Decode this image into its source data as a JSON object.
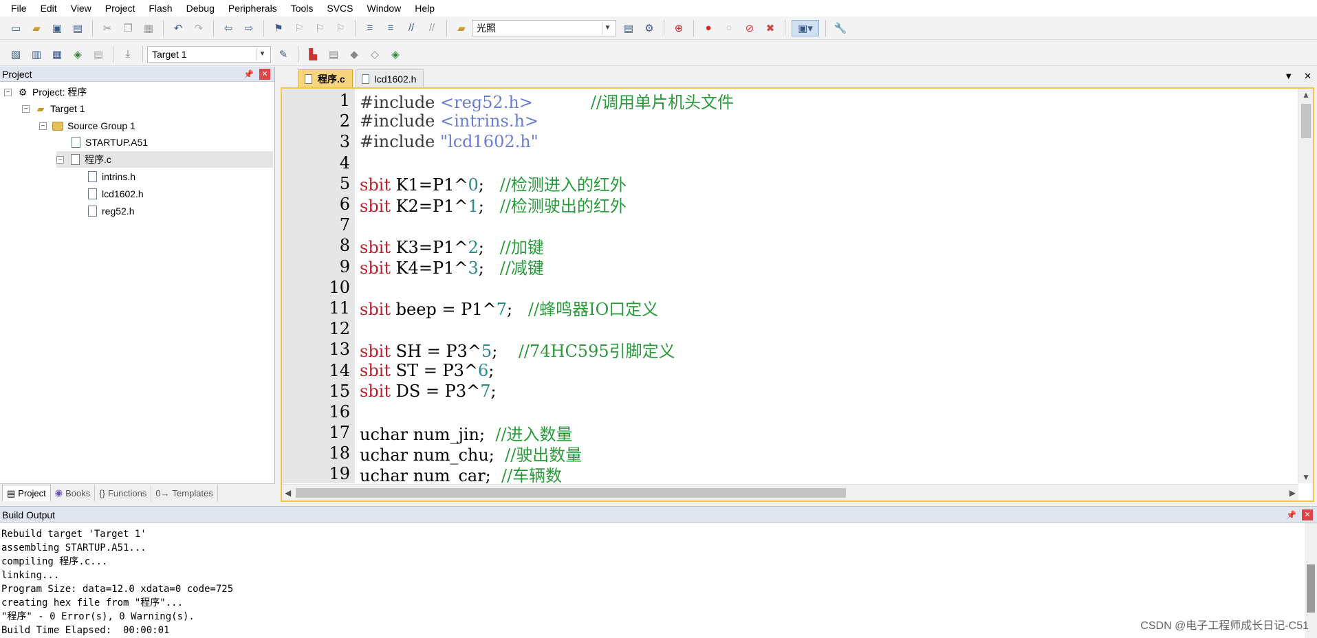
{
  "menu": [
    "File",
    "Edit",
    "View",
    "Project",
    "Flash",
    "Debug",
    "Peripherals",
    "Tools",
    "SVCS",
    "Window",
    "Help"
  ],
  "toolbar1": {
    "find_value": "光照"
  },
  "toolbar2": {
    "target_value": "Target 1"
  },
  "project_panel": {
    "title": "Project",
    "tree": [
      {
        "label": "Project: 程序"
      },
      {
        "label": "Target 1"
      },
      {
        "label": "Source Group 1"
      },
      {
        "label": "STARTUP.A51"
      },
      {
        "label": "程序.c"
      },
      {
        "label": "intrins.h"
      },
      {
        "label": "lcd1602.h"
      },
      {
        "label": "reg52.h"
      }
    ],
    "tabs": [
      "Project",
      "Books",
      "Functions",
      "Templates"
    ]
  },
  "editor": {
    "tabs": [
      "程序.c",
      "lcd1602.h"
    ],
    "lines": [
      {
        "n": "1",
        "parts": [
          [
            "pp",
            "#include "
          ],
          [
            "str",
            "<reg52.h>"
          ],
          [
            "plain",
            "           "
          ],
          [
            "cm",
            "//调用单片机头文件"
          ]
        ]
      },
      {
        "n": "2",
        "parts": [
          [
            "pp",
            "#include "
          ],
          [
            "str",
            "<intrins.h>"
          ]
        ]
      },
      {
        "n": "3",
        "parts": [
          [
            "pp",
            "#include "
          ],
          [
            "str",
            "\"lcd1602.h\""
          ]
        ]
      },
      {
        "n": "4",
        "parts": []
      },
      {
        "n": "5",
        "parts": [
          [
            "kw",
            "sbit"
          ],
          [
            "plain",
            " K1=P1^"
          ],
          [
            "num",
            "0"
          ],
          [
            "plain",
            ";   "
          ],
          [
            "cm",
            "//检测进入的红外"
          ]
        ]
      },
      {
        "n": "6",
        "parts": [
          [
            "kw",
            "sbit"
          ],
          [
            "plain",
            " K2=P1^"
          ],
          [
            "num",
            "1"
          ],
          [
            "plain",
            ";   "
          ],
          [
            "cm",
            "//检测驶出的红外"
          ]
        ]
      },
      {
        "n": "7",
        "parts": []
      },
      {
        "n": "8",
        "parts": [
          [
            "kw",
            "sbit"
          ],
          [
            "plain",
            " K3=P1^"
          ],
          [
            "num",
            "2"
          ],
          [
            "plain",
            ";   "
          ],
          [
            "cm",
            "//加键"
          ]
        ]
      },
      {
        "n": "9",
        "parts": [
          [
            "kw",
            "sbit"
          ],
          [
            "plain",
            " K4=P1^"
          ],
          [
            "num",
            "3"
          ],
          [
            "plain",
            ";   "
          ],
          [
            "cm",
            "//减键"
          ]
        ]
      },
      {
        "n": "10",
        "parts": []
      },
      {
        "n": "11",
        "parts": [
          [
            "kw",
            "sbit"
          ],
          [
            "plain",
            " beep = P1^"
          ],
          [
            "num",
            "7"
          ],
          [
            "plain",
            ";   "
          ],
          [
            "cm",
            "//蜂鸣器IO口定义"
          ]
        ]
      },
      {
        "n": "12",
        "parts": []
      },
      {
        "n": "13",
        "parts": [
          [
            "kw",
            "sbit"
          ],
          [
            "plain",
            " SH = P3^"
          ],
          [
            "num",
            "5"
          ],
          [
            "plain",
            ";    "
          ],
          [
            "cm",
            "//74HC595引脚定义"
          ]
        ]
      },
      {
        "n": "14",
        "parts": [
          [
            "kw",
            "sbit"
          ],
          [
            "plain",
            " ST = P3^"
          ],
          [
            "num",
            "6"
          ],
          [
            "plain",
            ";"
          ]
        ]
      },
      {
        "n": "15",
        "parts": [
          [
            "kw",
            "sbit"
          ],
          [
            "plain",
            " DS = P3^"
          ],
          [
            "num",
            "7"
          ],
          [
            "plain",
            ";"
          ]
        ]
      },
      {
        "n": "16",
        "parts": []
      },
      {
        "n": "17",
        "parts": [
          [
            "plain",
            "uchar num_jin;  "
          ],
          [
            "cm",
            "//进入数量"
          ]
        ]
      },
      {
        "n": "18",
        "parts": [
          [
            "plain",
            "uchar num_chu;  "
          ],
          [
            "cm",
            "//驶出数量"
          ]
        ]
      },
      {
        "n": "19",
        "parts": [
          [
            "plain",
            "uchar num_car;  "
          ],
          [
            "cm",
            "//车辆数"
          ]
        ]
      }
    ]
  },
  "build_output": {
    "title": "Build Output",
    "lines": [
      "Rebuild target 'Target 1'",
      "assembling STARTUP.A51...",
      "compiling 程序.c...",
      "linking...",
      "Program Size: data=12.0 xdata=0 code=725",
      "creating hex file from \"程序\"...",
      "\"程序\" - 0 Error(s), 0 Warning(s).",
      "Build Time Elapsed:  00:00:01"
    ]
  },
  "watermark": "CSDN @电子工程师成长日记-C51"
}
